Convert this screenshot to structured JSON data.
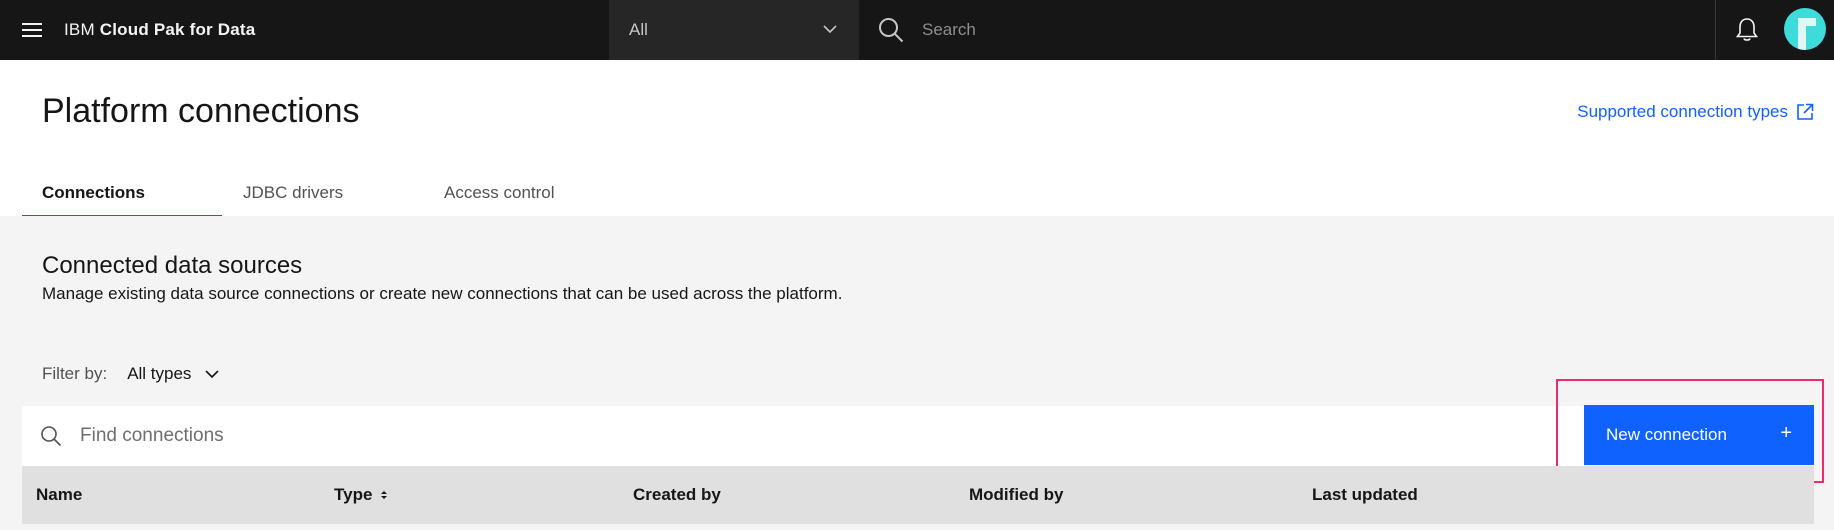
{
  "topbar": {
    "brand_prefix": "IBM",
    "brand_name": "Cloud Pak for Data",
    "scope_value": "All",
    "search_placeholder": "Search"
  },
  "header": {
    "title": "Platform connections",
    "supported_link": "Supported connection types"
  },
  "tabs": [
    {
      "label": "Connections",
      "active": true
    },
    {
      "label": "JDBC drivers",
      "active": false
    },
    {
      "label": "Access control",
      "active": false
    }
  ],
  "section": {
    "title": "Connected data sources",
    "description": "Manage existing data source connections or create new connections that can be used across the platform."
  },
  "filter": {
    "label": "Filter by:",
    "value": "All types"
  },
  "find": {
    "placeholder": "Find connections"
  },
  "new_connection": {
    "label": "New connection",
    "plus": "+"
  },
  "table": {
    "columns": [
      "Name",
      "Type",
      "Created by",
      "Modified by",
      "Last updated"
    ]
  },
  "colors": {
    "primary": "#0f62fe",
    "highlight": "#ee2a6f",
    "topbar": "#161616"
  }
}
